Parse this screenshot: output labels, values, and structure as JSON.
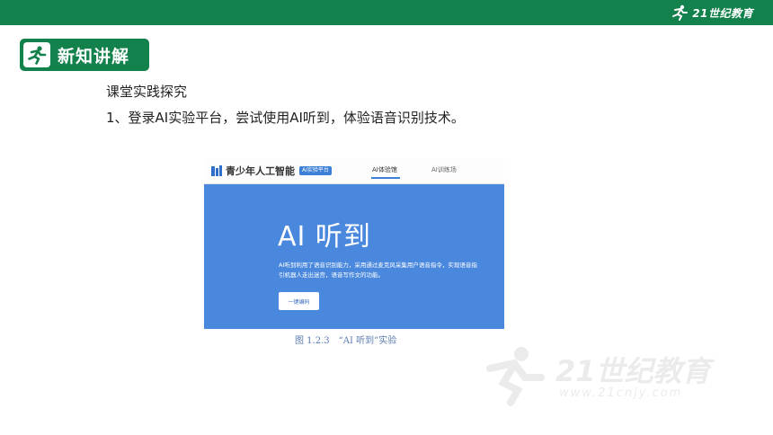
{
  "header": {
    "logo_text": "21世纪教育",
    "brand_color": "#12814b"
  },
  "section": {
    "title": "新知讲解",
    "icon": "runner-icon"
  },
  "content": {
    "subtitle": "课堂实践探究",
    "bullet": "1、登录AI实验平台，尝试使用AI听到，体验语音识别技术。"
  },
  "figure": {
    "brand": "青少年人工智能",
    "tag": "AI实验平台",
    "nav": [
      "AI体验馆",
      "AI训练场"
    ],
    "hero_title": "AI 听到",
    "hero_desc": "AI听到利用了语音识别能力，采用通过麦克风采集用户语音指令，实现语音指引机器人走出迷宫，语音写作文的功能。",
    "button_label": "一键编码",
    "caption": "图 1.2.3　“AI 听到”实验",
    "hero_color": "#4a88de"
  },
  "watermark": {
    "text": "21世纪教育",
    "url": "www.21cnjy.com"
  }
}
